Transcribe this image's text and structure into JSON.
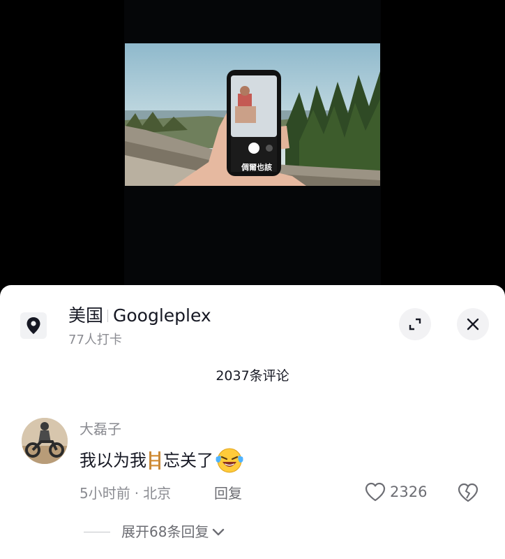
{
  "video": {
    "subtitle": "倜爾也該"
  },
  "location": {
    "region": "美国",
    "place": "Googleplex",
    "checkins": "77人打卡",
    "icon": "map-pin-icon"
  },
  "comments": {
    "count_label": "2037条评论",
    "items": [
      {
        "username": "大磊子",
        "text_before": "我以为我",
        "text_after": "忘关了",
        "inline_emoji": "ladder-emoji",
        "end_emoji": "crying-laughing-emoji",
        "time": "5小时前",
        "dot": "·",
        "city": "北京",
        "reply_label": "回复",
        "likes": "2326",
        "expand_label": "展开68条回复"
      }
    ]
  },
  "colors": {
    "primary_text": "#161823",
    "secondary_text": "#8a8b91",
    "sheet_bg": "#ffffff"
  }
}
